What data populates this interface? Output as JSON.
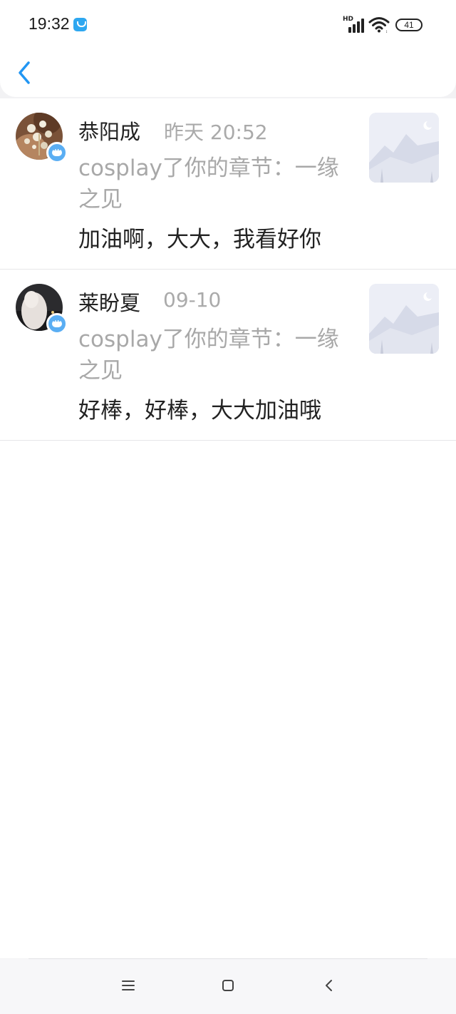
{
  "status_bar": {
    "time": "19:32",
    "network_label": "HD",
    "battery": "41"
  },
  "header": {
    "back_icon": "chevron-left-icon",
    "accent_color": "#2196f3"
  },
  "notifications": [
    {
      "name": "恭阳成",
      "date": "昨天 20:52",
      "action": "cosplay了你的章节：一缘之见",
      "comment": "加油啊，大大，我看好你"
    },
    {
      "name": "莱盼夏",
      "date": "09-10",
      "action": "cosplay了你的章节：一缘之见",
      "comment": "好棒，好棒，大大加油哦"
    }
  ],
  "nav_bar": {
    "icons": [
      "menu-icon",
      "home-icon",
      "back-icon"
    ]
  }
}
